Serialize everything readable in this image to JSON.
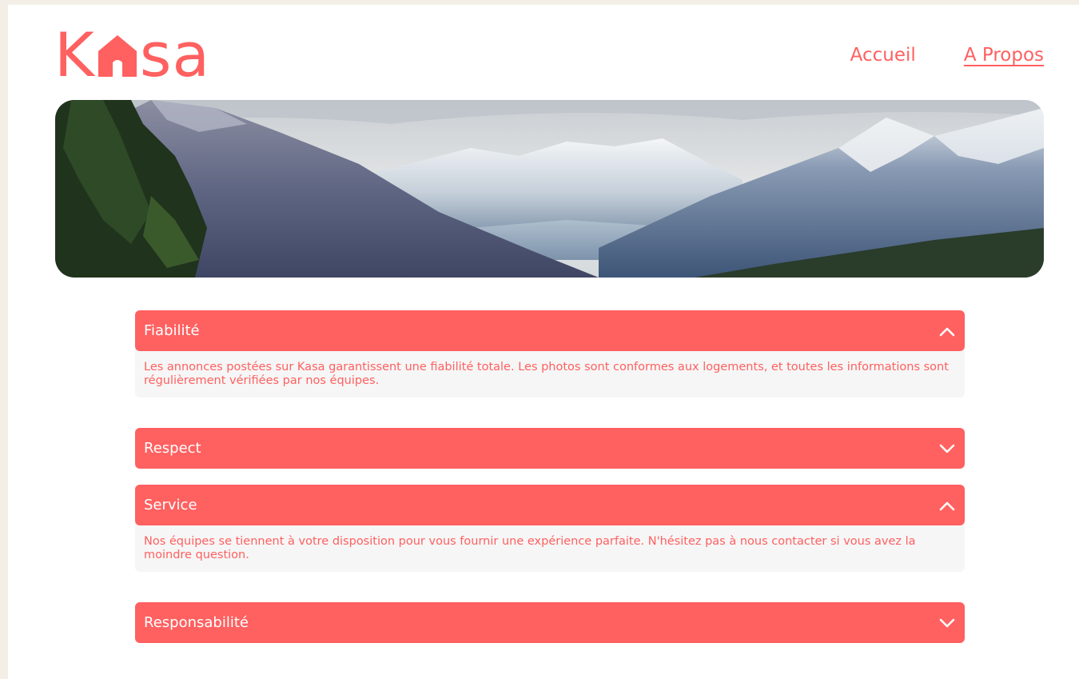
{
  "brand": {
    "logo_left": "K",
    "logo_right": "sa",
    "accent_color": "#ff6060"
  },
  "nav": {
    "items": [
      {
        "label": "Accueil",
        "active": false
      },
      {
        "label": "A Propos",
        "active": true
      }
    ]
  },
  "banner": {
    "icon": "mountain-landscape-image"
  },
  "collapses": [
    {
      "title": "Fiabilité",
      "open": true,
      "text": "Les annonces postées sur Kasa garantissent une fiabilité totale. Les photos sont conformes aux logements, et toutes les informations sont régulièrement vérifiées par nos équipes."
    },
    {
      "title": "Respect",
      "open": false,
      "text": ""
    },
    {
      "title": "Service",
      "open": true,
      "text": "Nos équipes se tiennent à votre disposition pour vous fournir une expérience parfaite. N'hésitez pas à nous contacter si vous avez la moindre question."
    },
    {
      "title": "Responsabilité",
      "open": false,
      "text": ""
    }
  ]
}
